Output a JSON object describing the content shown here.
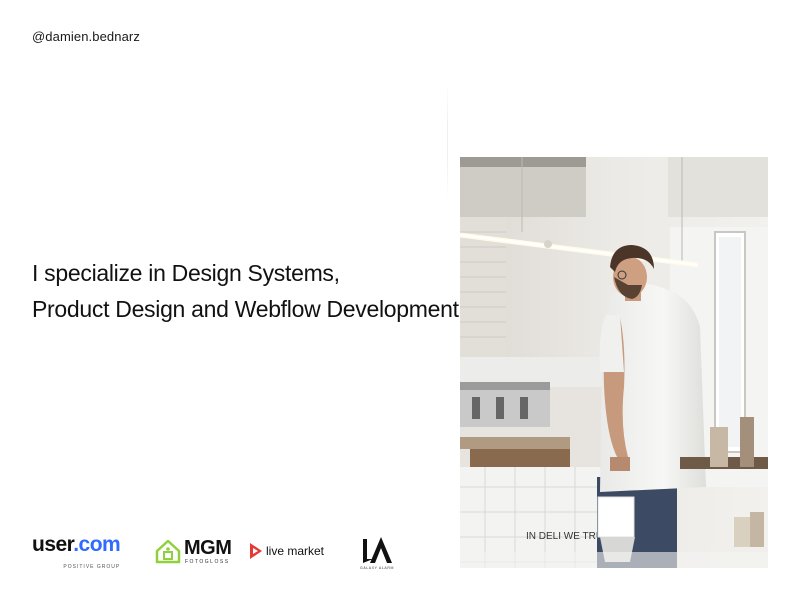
{
  "profile": {
    "handle": "@damien.bednarz"
  },
  "hero": {
    "headline_line1": "I specialize in Design Systems,",
    "headline_line2": "Product Design and Webflow Development",
    "photo_sign_text": "IN DELI WE TRUST"
  },
  "clients": [
    {
      "name": "user.com",
      "part1": "user",
      "part2": ".com",
      "tagline": "POSITIVE GROUP",
      "icon": "user-com-logo"
    },
    {
      "name": "MGM",
      "tagline": "FOTOGLOSS",
      "icon": "mgm-house-logo"
    },
    {
      "name": "live market",
      "icon": "live-market-logo"
    },
    {
      "name": "LA",
      "tagline": "GALAXY ALARM",
      "icon": "la-logo"
    }
  ],
  "colors": {
    "background": "#ffffff",
    "text": "#111111",
    "user_dot": "#2f6bff",
    "mgm_green": "#8ed13a",
    "live_red": "#e53935"
  }
}
